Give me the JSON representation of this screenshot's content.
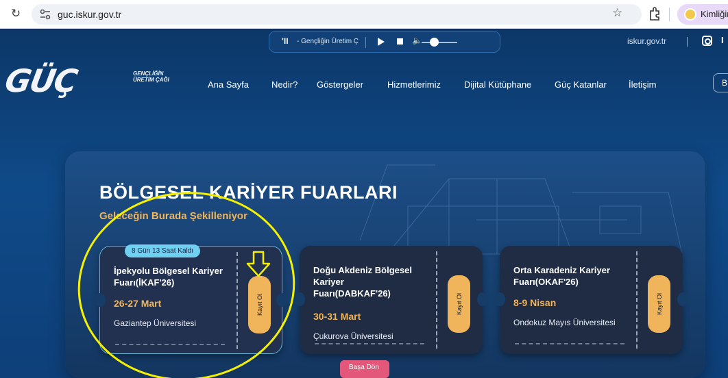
{
  "browser": {
    "url": "guc.iskur.gov.tr",
    "profile_label": "Kimliğin"
  },
  "player": {
    "mark": "'II",
    "title": "- Gençliğin Üretim Ç"
  },
  "topbar": {
    "site_link": "iskur.gov.tr",
    "more_label": "I"
  },
  "logo": {
    "main": "GÜÇ",
    "tagline_line1": "GENÇLİĞİN",
    "tagline_line2": "ÜRETİM ÇAĞI"
  },
  "nav": {
    "items": [
      "Ana Sayfa",
      "Nedir?",
      "Göstergeler",
      "Hizmetlerimiz",
      "Dijital Kütüphane",
      "Güç Katanlar",
      "İletişim"
    ],
    "button_label": "B"
  },
  "hero": {
    "title": "BÖLGESEL KARİYER FUARLARI",
    "subtitle": "Geleceğin Burada Şekilleniyor"
  },
  "cards": [
    {
      "badge": "8 Gün 13 Saat Kaldı",
      "name": "İpekyolu Bölgesel Kariyer Fuarı(İKAF'26)",
      "date": "26-27 Mart",
      "university": "Gaziantep Üniversitesi",
      "button": "Kayıt Ol"
    },
    {
      "name": "Doğu Akdeniz Bölgesel Kariyer Fuarı(DABKAF'26)",
      "date": "30-31 Mart",
      "university": "Çukurova Üniversitesi",
      "button": "Kayıt Ol"
    },
    {
      "name": "Orta Karadeniz Kariyer Fuarı(OKAF'26)",
      "date": "8-9 Nisan",
      "university": "Ondokuz Mayıs Üniversitesi",
      "button": "Kayıt Ol"
    }
  ],
  "back_to_top": "Başa Dön",
  "colors": {
    "accent": "#f0b45a",
    "badge": "#6fd0f2",
    "annotation": "#f4f000",
    "back_to_top": "#e2577a"
  }
}
